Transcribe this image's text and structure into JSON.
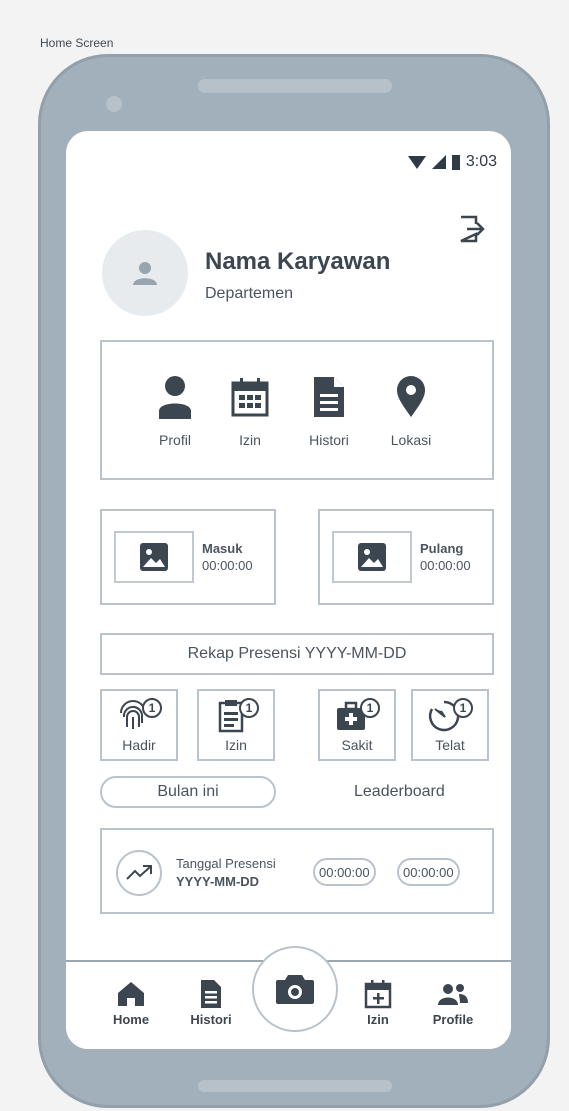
{
  "caption": "Home Screen",
  "status": {
    "time": "3:03"
  },
  "profile": {
    "name": "Nama Karyawan",
    "department": "Departemen"
  },
  "menu": [
    {
      "label": "Profil",
      "icon": "person-icon"
    },
    {
      "label": "Izin",
      "icon": "calendar-icon"
    },
    {
      "label": "Histori",
      "icon": "document-icon"
    },
    {
      "label": "Lokasi",
      "icon": "location-pin-icon"
    }
  ],
  "attendance": {
    "masuk": {
      "label": "Masuk",
      "time": "00:00:00"
    },
    "pulang": {
      "label": "Pulang",
      "time": "00:00:00"
    }
  },
  "rekap": "Rekap Presensi YYYY-MM-DD",
  "stats": [
    {
      "label": "Hadir",
      "count": "1",
      "icon": "fingerprint-icon"
    },
    {
      "label": "Izin",
      "count": "1",
      "icon": "clipboard-icon"
    },
    {
      "label": "Sakit",
      "count": "1",
      "icon": "medical-bag-icon"
    },
    {
      "label": "Telat",
      "count": "1",
      "icon": "timer-icon"
    }
  ],
  "tabs": {
    "bulan": "Bulan ini",
    "leaderboard": "Leaderboard"
  },
  "presensi": {
    "title": "Tanggal Presensi",
    "date": "YYYY-MM-DD",
    "time_in": "00:00:00",
    "time_out": "00:00:00"
  },
  "nav": {
    "home": "Home",
    "histori": "Histori",
    "izin": "Izin",
    "profile": "Profile"
  },
  "colors": {
    "phone_frame": "#a2b0bc",
    "border": "#b9c3cc",
    "text": "#3c4650"
  }
}
